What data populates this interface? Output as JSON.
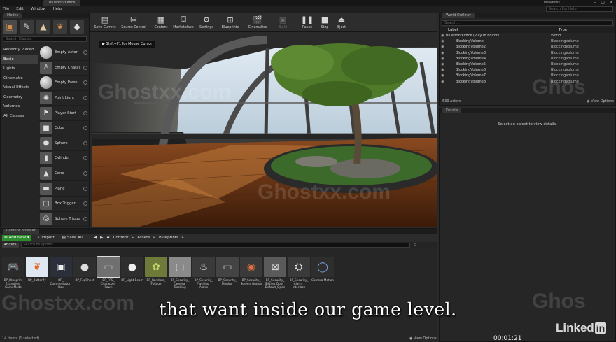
{
  "titlebar": {
    "tab": "BlueprintOffice",
    "project": "Meadows",
    "win_min": "–",
    "win_max": "□",
    "win_close": "✕"
  },
  "menu": {
    "items": [
      "File",
      "Edit",
      "Window",
      "Help"
    ],
    "search_placeholder": "Search For Help"
  },
  "modes": {
    "tab": "Modes",
    "search_placeholder": "Search Classes",
    "categories": [
      "Recently Placed",
      "Basic",
      "Lights",
      "Cinematic",
      "Visual Effects",
      "Geometry",
      "Volumes",
      "All Classes"
    ],
    "items": [
      "Empty Actor",
      "Empty Charac",
      "Empty Pawn",
      "Point Light",
      "Player Start",
      "Cube",
      "Sphere",
      "Cylinder",
      "Cone",
      "Plane",
      "Box Trigger",
      "Sphere Trigge"
    ]
  },
  "toolbar": {
    "save_current": "Save Current",
    "source_control": "Source Control",
    "content": "Content",
    "marketplace": "Marketplace",
    "settings": "Settings",
    "blueprints": "Blueprints",
    "cinematics": "Cinematics",
    "build": "Build",
    "pause": "Pause",
    "stop": "Stop",
    "eject": "Eject"
  },
  "viewport": {
    "hint": "Shift+F1 for Mouse Cursor"
  },
  "content_browser": {
    "tab": "Content Browser",
    "add_new": "Add New",
    "import": "Import",
    "save_all": "Save All",
    "breadcrumb": [
      "Content",
      "Assets",
      "Blueprints"
    ],
    "filters": "Filters",
    "search_placeholder": "Search Blueprints",
    "assets": [
      "BP_Blueprint Examples_ GameMode",
      "BP_Butterfly",
      "BP_ Commentator_ Box",
      "BP_FogSheet",
      "BP_FPS_ Character_ Pawn",
      "BP_Light Beam",
      "BP_Random_ Foliage",
      "BP_Security_ Camera_ Tracking",
      "BP_Security_ Flashing_ Alarm",
      "BP_Security_ Monitor",
      "BP_Security_ Screen_Button",
      "BP_Security_ Sliding_Door_ Default_Open",
      "BP_Security_ Alarm_ Interface",
      "Camera Motion"
    ],
    "status": "14 items (1 selected)",
    "view_options": "View Options"
  },
  "world_outliner": {
    "tab": "World Outliner",
    "search_placeholder": "Search...",
    "col_label": "Label",
    "col_type": "Type",
    "rows": [
      {
        "name": "BlueprintOffice (Play In Editor)",
        "type": "World"
      },
      {
        "name": "BlockingVolume",
        "type": "BlockingVolume"
      },
      {
        "name": "BlockingVolume2",
        "type": "BlockingVolume"
      },
      {
        "name": "BlockingVolume3",
        "type": "BlockingVolume"
      },
      {
        "name": "BlockingVolume4",
        "type": "BlockingVolume"
      },
      {
        "name": "BlockingVolume5",
        "type": "BlockingVolume"
      },
      {
        "name": "BlockingVolume6",
        "type": "BlockingVolume"
      },
      {
        "name": "BlockingVolume7",
        "type": "BlockingVolume"
      },
      {
        "name": "BlockingVolume8",
        "type": "BlockingVolume"
      }
    ],
    "count": "639 actors",
    "view_options": "View Options"
  },
  "details": {
    "tab": "Details",
    "message": "Select an object to view details."
  },
  "subtitle": "that want inside our game level.",
  "timer": "00:01:21",
  "brand": {
    "linked": "Linked",
    "in": "in"
  },
  "watermark": "Ghostxx.com",
  "watermark_short": "Ghos"
}
